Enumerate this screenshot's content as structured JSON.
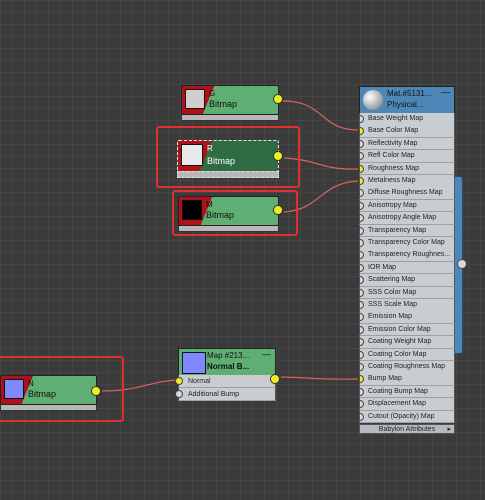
{
  "bitmap_nodes": [
    {
      "id": "g",
      "letter": "G",
      "type": "Bitmap",
      "thumb_color": "#cfcfcf"
    },
    {
      "id": "r",
      "letter": "R",
      "type": "Bitmap",
      "thumb_color": "#e8e8e8"
    },
    {
      "id": "m",
      "letter": "M",
      "type": "Bitmap",
      "thumb_color": "#000000"
    },
    {
      "id": "n",
      "letter": "N",
      "type": "Bitmap",
      "thumb_color": "#8088ff"
    }
  ],
  "normal_bump_node": {
    "title": "Map #213...",
    "subtitle": "Normal B...",
    "minimize": "—",
    "slots": [
      "Normal",
      "Additional Bump"
    ]
  },
  "material_node": {
    "title": "Mat.#5131...",
    "subtitle": "Physical...",
    "minimize": "—",
    "slots": [
      "Base Weight Map",
      "Base Color Map",
      "Reflectivity Map",
      "Refl Color Map",
      "Roughness Map",
      "Metalness Map",
      "Diffuse Roughness Map",
      "Anisotropy Map",
      "Anisotropy Angle Map",
      "Transparency Map",
      "Transparency Color Map",
      "Transparency Roughnes...",
      "IOR Map",
      "Scattering Map",
      "SSS Color Map",
      "SSS Scale Map",
      "Emission Map",
      "Emission Color Map",
      "Coating Weight Map",
      "Coating Color Map",
      "Coating Roughness Map",
      "Bump Map",
      "Coating Bump Map",
      "Displacement Map",
      "Cutout (Opacity) Map"
    ],
    "connected_slots": [
      "Base Color Map",
      "Roughness Map",
      "Metalness Map",
      "Bump Map"
    ],
    "footer": "Babylon Attributes",
    "footer_arrow": "▸"
  },
  "colors": {
    "wire": "#e06060",
    "socket_active": "#e8f020",
    "highlight": "#e03030",
    "node_green": "#5fae74",
    "node_red": "#b01018",
    "material_blue": "#4d87b8"
  }
}
